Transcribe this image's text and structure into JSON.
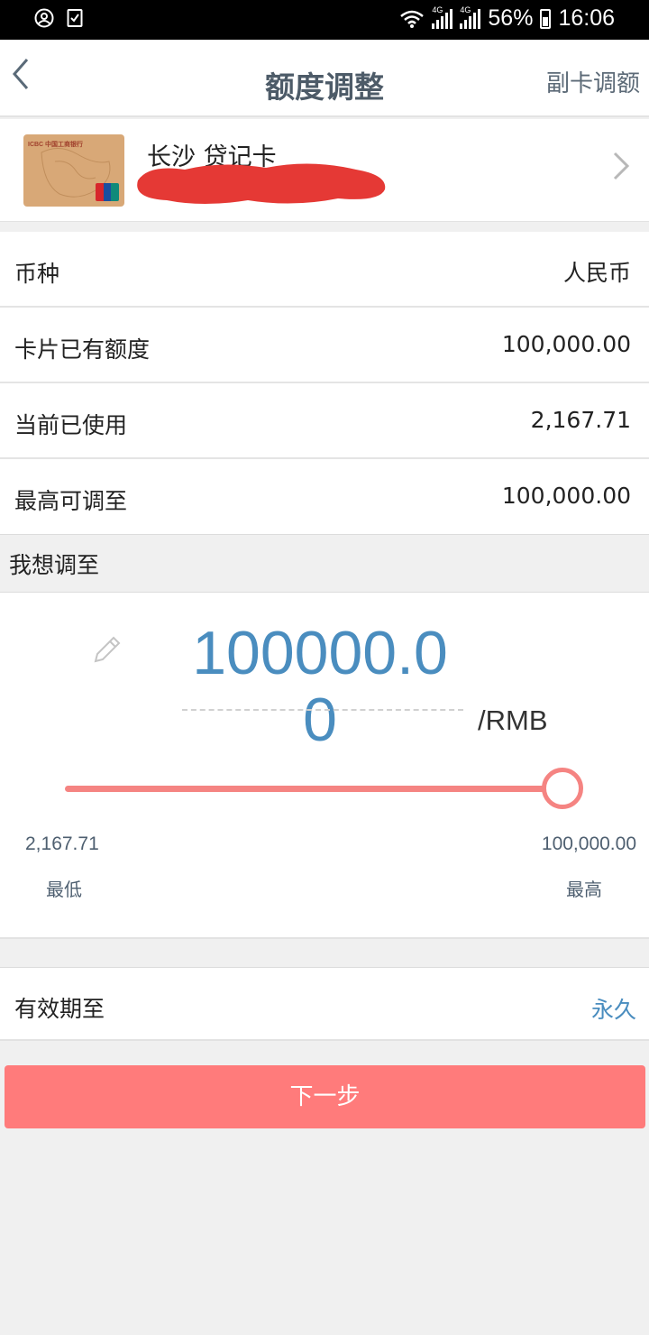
{
  "status_bar": {
    "battery": "56%",
    "time": "16:06",
    "network_1": "4G",
    "network_2": "4G"
  },
  "header": {
    "title": "额度调整",
    "right_action": "副卡调额"
  },
  "card": {
    "name": "长沙 贷记卡",
    "bank_text": "ICBC 中国工商银行"
  },
  "info_rows": [
    {
      "label": "币种",
      "value": "人民币"
    },
    {
      "label": "卡片已有额度",
      "value": "100,000.00"
    },
    {
      "label": "当前已使用",
      "value": "2,167.71"
    },
    {
      "label": "最高可调至",
      "value": "100,000.00"
    }
  ],
  "adjust": {
    "section_label": "我想调至",
    "amount": "100000.00",
    "unit": "/RMB",
    "slider_fraction": 1.0,
    "min_value": "2,167.71",
    "min_label": "最低",
    "max_value": "100,000.00",
    "max_label": "最高"
  },
  "validity": {
    "label": "有效期至",
    "value": "永久"
  },
  "next_button": "下一步",
  "colors": {
    "accent_blue": "#4a8dbf",
    "slider_red": "#f58482",
    "button_red": "#ff7b7b",
    "redaction": "#e53935"
  }
}
